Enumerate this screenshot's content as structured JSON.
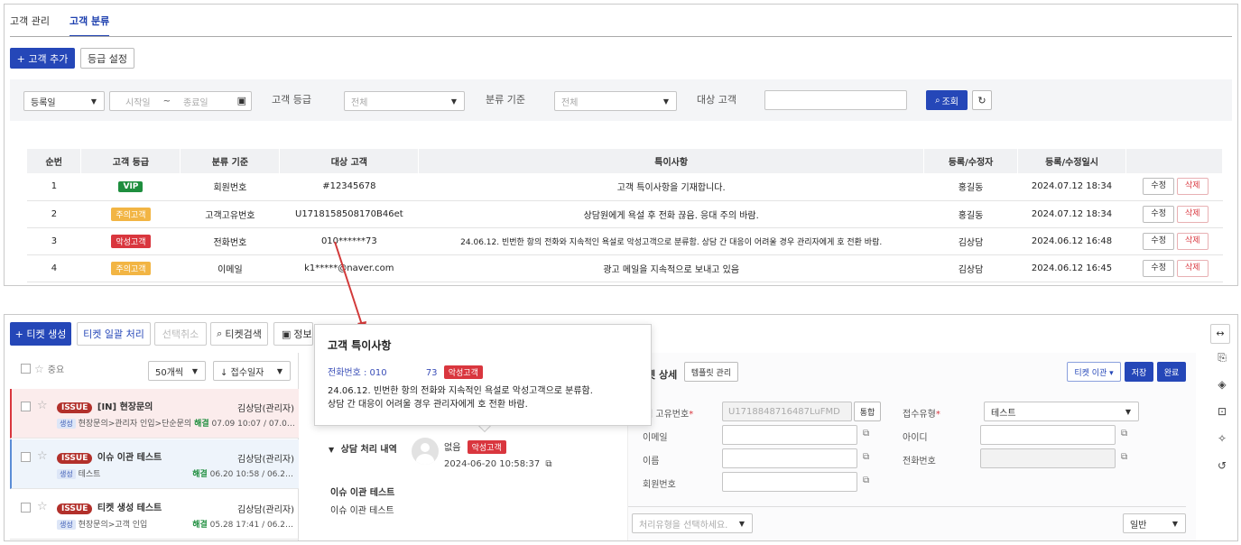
{
  "tabs": [
    {
      "label": "고객 관리"
    },
    {
      "label": "고객 분류"
    }
  ],
  "actions": {
    "add_customer": "+ 고객 추가",
    "grade_setting": "등급 설정"
  },
  "filter": {
    "date_type": "등록일",
    "start_placeholder": "시작일",
    "tilde": "~",
    "end_placeholder": "종료일",
    "grade_label": "고객 등급",
    "grade_value": "전체",
    "criteria_label": "분류 기준",
    "criteria_value": "전체",
    "target_label": "대상 고객",
    "target_value": "",
    "search_button": "조회"
  },
  "table": {
    "headers": [
      "순번",
      "고객 등급",
      "분류 기준",
      "대상 고객",
      "특이사항",
      "등록/수정자",
      "등록/수정일시",
      ""
    ],
    "rows": [
      {
        "no": "1",
        "grade": "VIP",
        "criteria": "회원번호",
        "target": "#12345678",
        "note": "고객 특이사항을 기재합니다.",
        "editor": "홍길동",
        "date": "2024.07.12 18:34"
      },
      {
        "no": "2",
        "grade": "주의고객",
        "criteria": "고객고유번호",
        "target": "U1718158508170B46et",
        "note": "상담원에게 욕설 후 전화 끊음. 응대 주의 바람.",
        "editor": "홍길동",
        "date": "2024.07.12 18:34"
      },
      {
        "no": "3",
        "grade": "악성고객",
        "criteria": "전화번호",
        "target": "010******73",
        "note": "24.06.12. 빈번한 항의 전화와 지속적인 욕설로 악성고객으로 분류함. 상담 간 대응이 어려울 경우 관리자에게 호 전환 바람.",
        "editor": "김상담",
        "date": "2024.06.12 16:48"
      },
      {
        "no": "4",
        "grade": "주의고객",
        "criteria": "이메일",
        "target": "k1*****@naver.com",
        "note": "광고 메일을 지속적으로 보내고 있음",
        "editor": "김상담",
        "date": "2024.06.12 16:45"
      }
    ],
    "edit_label": "수정",
    "delete_label": "삭제"
  },
  "ticket_toolbar": {
    "create": "+ 티켓 생성",
    "bulk": "티켓 일괄 처리",
    "cancel": "선택취소",
    "search": "티켓검색",
    "info": "정보"
  },
  "list": {
    "sort_label": "중요",
    "page_size": "50개씩",
    "order": "↓ 접수일자",
    "items": [
      {
        "badge": "ISSUE",
        "title": "[IN] 현장문의",
        "owner": "김상담(관리자)",
        "tag": "생성",
        "path": "현장문의>관리자 인입>단순문의",
        "status": "해결",
        "time": "07.09 10:07 / 07.0…"
      },
      {
        "badge": "ISSUE",
        "title": "이슈 이관 테스트",
        "owner": "김상담(관리자)",
        "tag": "생성",
        "path": "테스트",
        "status": "해결",
        "time": "06.20 10:58 / 06.2…"
      },
      {
        "badge": "ISSUE",
        "title": "티켓 생성 테스트",
        "owner": "김상담(관리자)",
        "tag": "생성",
        "path": "현장문의>고객 인입",
        "status": "해결",
        "time": "05.28 17:41 / 06.2…"
      }
    ]
  },
  "history": {
    "title": "상담 처리 내역",
    "name": "없음",
    "badge": "악성고객",
    "time": "2024-06-20 10:58:37",
    "sub_title": "이슈 이관 테스트",
    "sub_text": "이슈 이관 테스트"
  },
  "detail": {
    "title": "켓 상세",
    "template_btn": "템플릿 관리",
    "transfer_btn": "티켓 이관 ▾",
    "save_btn": "저장",
    "done_btn": "완료",
    "uid_label": "객 고유번호",
    "uid_value": "U1718848716487LuFMD",
    "merge_btn": "통합",
    "type_label": "접수유형",
    "type_value": "테스트",
    "email_label": "이메일",
    "id_label": "아이디",
    "name_label": "이름",
    "phone_label": "전화번호",
    "member_label": "회원번호",
    "process_placeholder": "처리유형을 선택하세요.",
    "general": "일반"
  },
  "tooltip": {
    "title": "고객 특이사항",
    "phone_prefix": "전화번호 : 010",
    "phone_suffix": "73",
    "badge": "악성고객",
    "line1": "24.06.12. 빈번한 항의 전화와 지속적인 욕설로 악성고객으로 분류함.",
    "line2": "상담 간 대응이 어려울 경우 관리자에게 호 전환 바람."
  },
  "colors": {
    "primary": "#2547b8",
    "danger": "#d9363e",
    "warning": "#f2b544",
    "vip": "#1e8e3e",
    "arrow": "#d23a3a"
  }
}
